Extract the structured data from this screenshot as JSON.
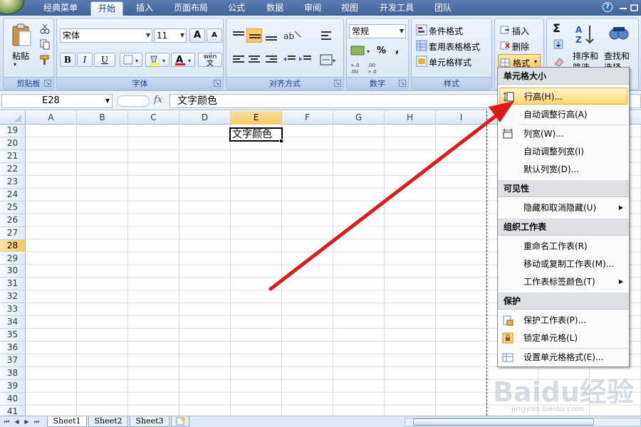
{
  "tabs": [
    "经典菜单",
    "开始",
    "插入",
    "页面布局",
    "公式",
    "数据",
    "审阅",
    "视图",
    "开发工具",
    "团队"
  ],
  "help": "?",
  "ribbon": {
    "clipboard": {
      "paste_label": "粘贴",
      "group_label": "剪贴板"
    },
    "font": {
      "font_name": "宋体",
      "font_size": "11",
      "bold": "B",
      "italic": "I",
      "underline": "U",
      "grow": "A",
      "shrink": "A",
      "wen": "wén",
      "group_label": "字体"
    },
    "align": {
      "group_label": "对齐方式"
    },
    "number": {
      "format": "常规",
      "percent": "%",
      "comma": ",",
      "inc": "+.0\n.00",
      "dec": ".00\n+.0",
      "group_label": "数字"
    },
    "style": {
      "cond": "条件格式",
      "table": "套用表格格式",
      "cell": "单元格样式",
      "group_label": "样式"
    },
    "cells": {
      "insert": "插入",
      "delete": "删除",
      "format": "格式"
    },
    "edit": {
      "sigma": "Σ",
      "sort": "排序和",
      "sort2": "筛选",
      "find": "查找和",
      "find2": "选择"
    }
  },
  "formula_bar": {
    "name_box": "E28",
    "fx": "fx",
    "content": "文字颜色"
  },
  "columns": [
    "A",
    "B",
    "C",
    "D",
    "E",
    "F",
    "G",
    "H",
    "I"
  ],
  "rows": [
    "19",
    "20",
    "21",
    "22",
    "23",
    "24",
    "25",
    "26",
    "27",
    "28",
    "29",
    "30",
    "31",
    "32",
    "33",
    "34",
    "35",
    "36",
    "37",
    "38",
    "39",
    "40",
    "41"
  ],
  "active_cell_value": "文字颜色",
  "sheets": [
    "Sheet1",
    "Sheet2",
    "Sheet3"
  ],
  "menu": {
    "sec1": "单元格大小",
    "row_height": "行高(H)...",
    "auto_row": "自动调整行高(A)",
    "col_width": "列宽(W)...",
    "auto_col": "自动调整列宽(I)",
    "default_col": "默认列宽(D)...",
    "sec2": "可见性",
    "hide": "隐藏和取消隐藏(U)",
    "sec3": "组织工作表",
    "rename": "重命名工作表(R)",
    "move": "移动或复制工作表(M)...",
    "tabcolor": "工作表标签颜色(T)",
    "sec4": "保护",
    "protect": "保护工作表(P)...",
    "lock": "锁定单元格(L)",
    "format_cells": "设置单元格格式(E)..."
  },
  "watermark": {
    "main": "Baidu经验",
    "sub": "jingyan.baidu.com"
  },
  "colors": {
    "accent": "#15428b",
    "arrow": "#e0191b",
    "highlight": "#fbd770"
  }
}
